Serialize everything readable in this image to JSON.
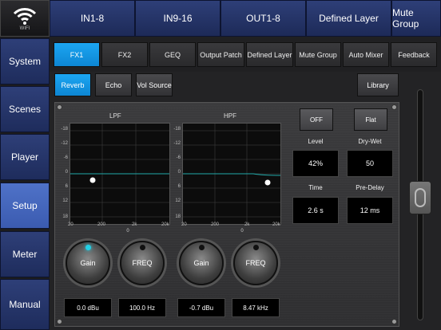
{
  "wifi": {
    "label": "WIFI",
    "icon": "wifi-icon"
  },
  "top_tabs": [
    "IN1-8",
    "IN9-16",
    "OUT1-8",
    "Defined Layer",
    "Mute Group"
  ],
  "side_nav": [
    "System",
    "Scenes",
    "Player",
    "Setup",
    "Meter",
    "Manual"
  ],
  "side_nav_active": "Setup",
  "sub_tabs": [
    "FX1",
    "FX2",
    "GEQ",
    "Output Patch",
    "Defined Layer",
    "Mute Group",
    "Auto Mixer",
    "Feedback"
  ],
  "sub_tab_active": "FX1",
  "fx_types": [
    "Reverb",
    "Echo",
    "Vol Source"
  ],
  "fx_type_active": "Reverb",
  "library_label": "Library",
  "lpf": {
    "title": "LPF",
    "y_ticks": [
      "-18",
      "-12",
      "-6",
      "0",
      "6",
      "12",
      "18"
    ],
    "x_ticks": [
      "20",
      "200",
      "2k",
      "20k"
    ],
    "gain_label": "Gain",
    "freq_label": "FREQ",
    "gain_zero": "0",
    "freq_zero": "0",
    "gain_value": "0.0 dBu",
    "freq_value": "100.0 Hz"
  },
  "hpf": {
    "title": "HPF",
    "y_ticks": [
      "-18",
      "-12",
      "-6",
      "0",
      "6",
      "12",
      "18"
    ],
    "x_ticks": [
      "20",
      "200",
      "2k",
      "20k"
    ],
    "gain_label": "Gain",
    "freq_label": "FREQ",
    "gain_zero": "0",
    "freq_zero": "0",
    "gain_value": "-0.7 dBu",
    "freq_value": "8.47 kHz"
  },
  "buttons": {
    "off": "OFF",
    "flat": "Flat"
  },
  "params": {
    "level": {
      "label": "Level",
      "value": "42%"
    },
    "dry_wet": {
      "label": "Dry-Wet",
      "value": "50"
    },
    "time": {
      "label": "Time",
      "value": "2.6 s"
    },
    "pre_delay": {
      "label": "Pre-Delay",
      "value": "12 ms"
    }
  },
  "colors": {
    "accent": "#1ca6f2",
    "nav": "#2e3f78",
    "nav_active": "#4f72c8",
    "knob_led": "#22d0e6"
  }
}
